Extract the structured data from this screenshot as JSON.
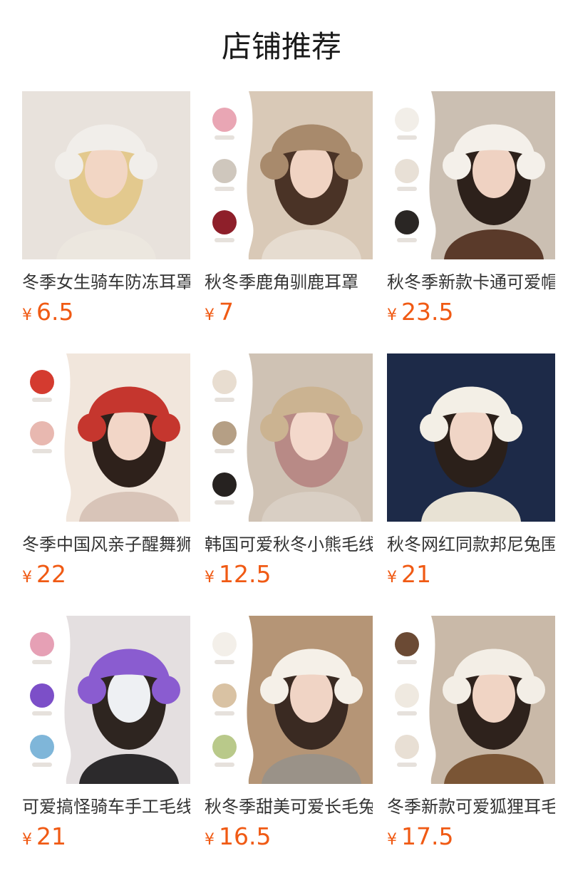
{
  "page": {
    "title": "店铺推荐"
  },
  "products": [
    {
      "name": "冬季女生骑车防冻耳罩",
      "currency": "¥",
      "price": "6.5",
      "image": "white-fur-earmuffs-photo",
      "bg": "#e8e2dc",
      "hat": "#f1eeea",
      "hair": "#e3c98e",
      "skin": "#f2d6c4",
      "body": "#ece7df",
      "swatches": []
    },
    {
      "name": "秋冬季鹿角驯鹿耳罩",
      "currency": "¥",
      "price": "7",
      "image": "reindeer-antler-earmuffs-photo",
      "bg": "#d9c9b7",
      "hat": "#a88a6c",
      "hair": "#4a3326",
      "skin": "#f0d3c2",
      "body": "#e6dcd0",
      "swatches": [
        "#e9a6b4",
        "#cfc7bd",
        "#8e1f2a"
      ]
    },
    {
      "name": "秋冬季新款卡通可爱帽子",
      "currency": "¥",
      "price": "23.5",
      "image": "bunny-ear-plush-hat-photo",
      "bg": "#cbbfb2",
      "hat": "#f4f0ea",
      "hair": "#2d211b",
      "skin": "#efd2c2",
      "body": "#5a3a2a",
      "swatches": [
        "#f2eee8",
        "#e8e0d6",
        "#2a2624"
      ]
    },
    {
      "name": "冬季中国风亲子醒舞狮帽",
      "currency": "¥",
      "price": "22",
      "image": "lion-dance-hat-photo",
      "bg": "#f1e6dc",
      "hat": "#c5362e",
      "hair": "#2e211b",
      "skin": "#f2d6c7",
      "body": "#d8c4b8",
      "swatches": [
        "#d43b2f",
        "#e8b8b0"
      ]
    },
    {
      "name": "韩国可爱秋冬小熊毛线帽",
      "currency": "¥",
      "price": "12.5",
      "image": "bear-ear-beanie-photo",
      "bg": "#cfc2b4",
      "hat": "#cbb391",
      "hair": "#b88a86",
      "skin": "#f3d8cb",
      "body": "#d9cfc4",
      "swatches": [
        "#e8ddd0",
        "#b59f85",
        "#262220"
      ]
    },
    {
      "name": "秋冬网红同款邦尼兔围巾帽",
      "currency": "¥",
      "price": "21",
      "image": "night-city-bunny-scarf-hat-photo",
      "bg": "#1d2a48",
      "hat": "#f3efe6",
      "hair": "#2b201a",
      "skin": "#f0d5c6",
      "body": "#e8e2d4",
      "swatches": []
    },
    {
      "name": "可爱搞怪骑车手工毛线帽",
      "currency": "¥",
      "price": "21",
      "image": "purple-monster-hat-photo",
      "bg": "#e4dfe0",
      "hat": "#8a5cd0",
      "hair": "#2e2520",
      "skin": "#eef0f3",
      "body": "#2c2a2c",
      "swatches": [
        "#e6a0b5",
        "#7c4fc8",
        "#7fb6d9"
      ]
    },
    {
      "name": "秋冬季甜美可爱长毛兔耳帽",
      "currency": "¥",
      "price": "16.5",
      "image": "long-fur-bunny-hat-photo",
      "bg": "#b59576",
      "hat": "#f5f0e8",
      "hair": "#3a2a22",
      "skin": "#f0d4c5",
      "body": "#9a9288",
      "swatches": [
        "#f3efe9",
        "#d9c2a3",
        "#b9c98a"
      ]
    },
    {
      "name": "冬季新款可爱狐狸耳毛绒帽",
      "currency": "¥",
      "price": "17.5",
      "image": "fox-ear-plush-hat-photo",
      "bg": "#c9b9a8",
      "hat": "#f3eee6",
      "hair": "#2e221c",
      "skin": "#f0d4c4",
      "body": "#7a5535",
      "swatches": [
        "#6b4a34",
        "#efe9e0",
        "#e8dfd4"
      ]
    }
  ]
}
